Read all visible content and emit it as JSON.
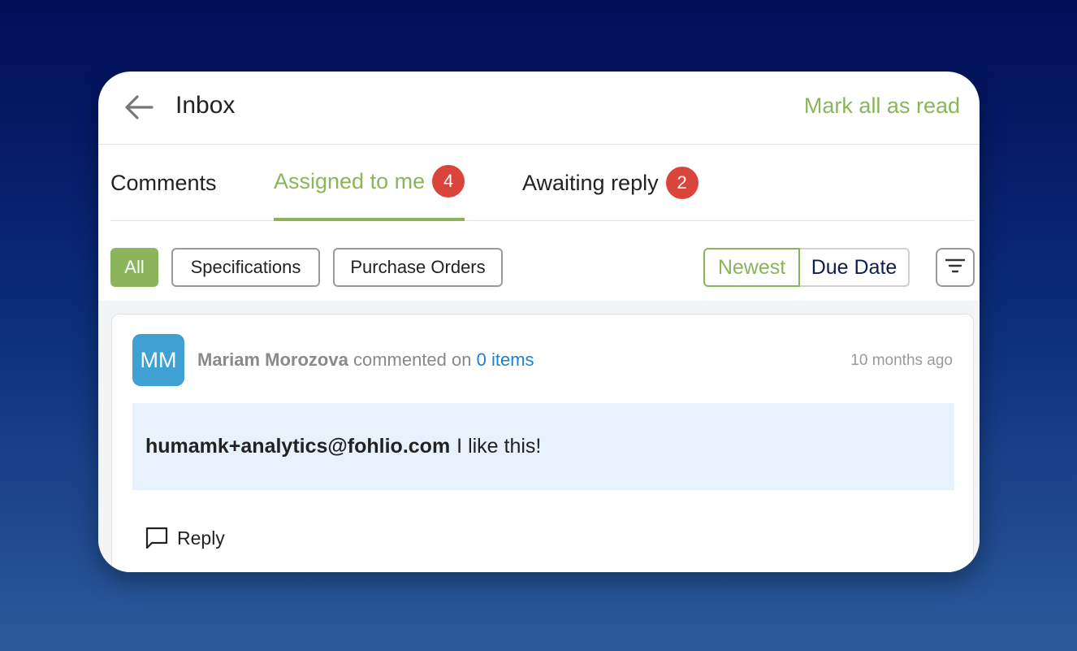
{
  "header": {
    "title": "Inbox",
    "mark_all_read": "Mark all as read"
  },
  "tabs": [
    {
      "label": "Comments",
      "badge": null
    },
    {
      "label": "Assigned to me",
      "badge": "4"
    },
    {
      "label": "Awaiting reply",
      "badge": "2"
    }
  ],
  "filters": {
    "chips": [
      "All",
      "Specifications",
      "Purchase Orders"
    ],
    "sort": [
      "Newest",
      "Due Date"
    ]
  },
  "comment": {
    "avatar_initials": "MM",
    "author": "Mariam Morozova",
    "action": "commented on",
    "target": "0 items",
    "time": "10 months ago",
    "mention": "humamk+analytics@fohlio.com",
    "text": "I like this!",
    "reply_label": "Reply"
  },
  "colors": {
    "accent_green": "#8ab55a",
    "badge_red": "#d9453a",
    "avatar_blue": "#3fa0d4",
    "link_blue": "#1f7fd1",
    "comment_bg": "#e8f2fc"
  },
  "icons": [
    "arrow-left-icon",
    "filter-lines-icon",
    "chat-bubble-icon"
  ]
}
